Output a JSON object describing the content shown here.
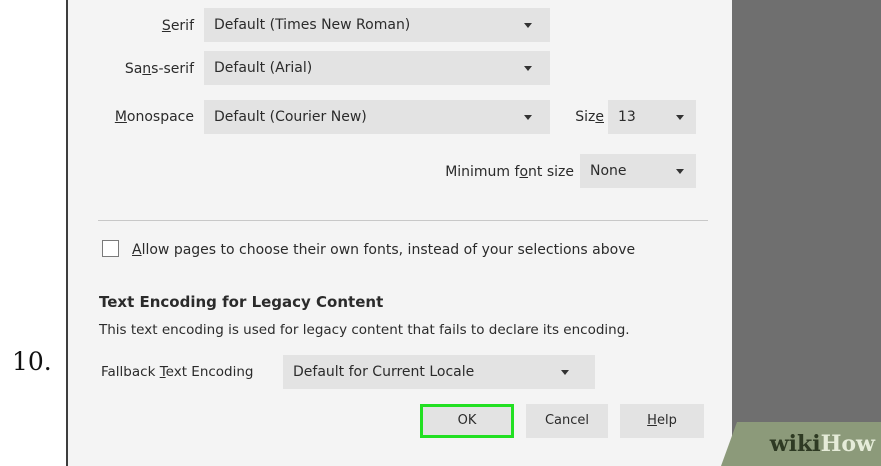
{
  "step_number": "10.",
  "fonts": {
    "serif": {
      "label_pre": "",
      "label_u": "S",
      "label_post": "erif",
      "value": "Default (Times New Roman)"
    },
    "sans_serif": {
      "label_pre": "Sa",
      "label_u": "n",
      "label_post": "s-serif",
      "value": "Default (Arial)"
    },
    "monospace": {
      "label_pre": "",
      "label_u": "M",
      "label_post": "onospace",
      "value": "Default (Courier New)"
    },
    "size": {
      "label_pre": "Siz",
      "label_u": "e",
      "label_post": "",
      "value": "13"
    },
    "minimum": {
      "label_pre": "Minimum f",
      "label_u": "o",
      "label_post": "nt size",
      "value": "None"
    }
  },
  "allow_fonts": {
    "checked": false,
    "label_u": "A",
    "label_post": "llow pages to choose their own fonts, instead of your selections above"
  },
  "encoding": {
    "heading": "Text Encoding for Legacy Content",
    "description": "This text encoding is used for legacy content that fails to declare its encoding.",
    "fallback_label_pre": "Fallback ",
    "fallback_label_u": "T",
    "fallback_label_post": "ext Encoding",
    "fallback_value": "Default for Current Locale"
  },
  "buttons": {
    "ok": "OK",
    "cancel": "Cancel",
    "help_u": "H",
    "help_post": "elp"
  },
  "watermark": {
    "wiki": "wiki",
    "how": "How"
  },
  "colors": {
    "highlight": "#22e022",
    "dialog_bg": "#f4f4f4",
    "dropdown_bg": "#e3e3e3",
    "backdrop": "#6f6f6f"
  }
}
